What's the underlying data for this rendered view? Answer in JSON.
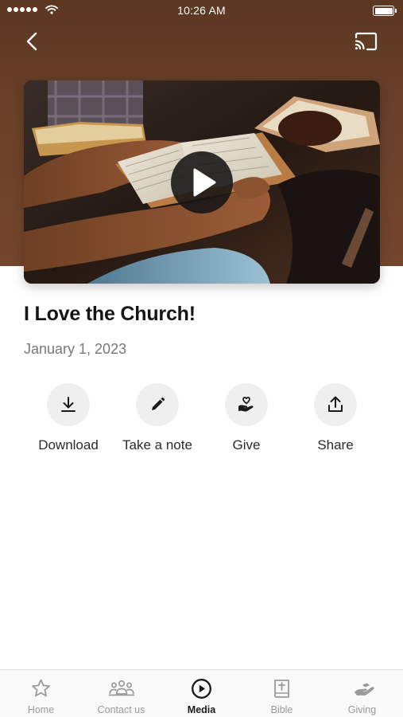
{
  "status_bar": {
    "time": "10:26 AM"
  },
  "nav": {
    "back_icon": "chevron-left-icon",
    "cast_icon": "cast-icon"
  },
  "video": {
    "thumbnail": "people holding open bibles",
    "play_icon": "play-icon"
  },
  "media": {
    "title": "I Love the Church!",
    "date": "January 1, 2023"
  },
  "actions": [
    {
      "label": "Download",
      "icon": "download-icon"
    },
    {
      "label": "Take a note",
      "icon": "pencil-icon"
    },
    {
      "label": "Give",
      "icon": "heart-hand-icon"
    },
    {
      "label": "Share",
      "icon": "share-icon"
    }
  ],
  "tabs": [
    {
      "label": "Home",
      "icon": "star-icon"
    },
    {
      "label": "Contact us",
      "icon": "people-icon"
    },
    {
      "label": "Media",
      "icon": "play-circle-icon",
      "active": true
    },
    {
      "label": "Bible",
      "icon": "bible-icon"
    },
    {
      "label": "Giving",
      "icon": "giving-hand-icon"
    }
  ],
  "colors": {
    "header": "#6a4029",
    "accent": "#1a1a1a",
    "muted": "#9a9a9a"
  }
}
